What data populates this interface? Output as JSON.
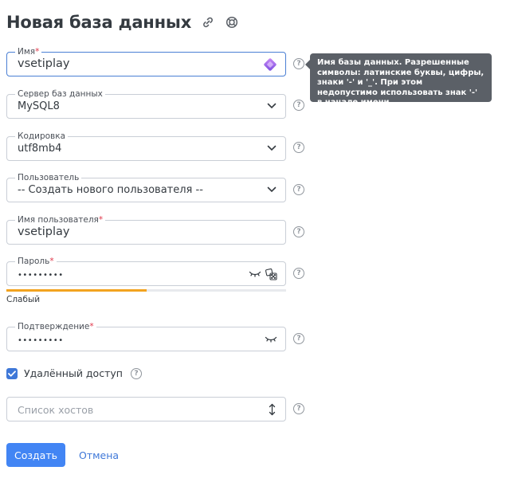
{
  "header": {
    "title": "Новая база данных",
    "icons": [
      "link-icon",
      "lifebuoy-icon"
    ]
  },
  "form": {
    "name": {
      "label": "Имя",
      "required_mark": "*",
      "value": "vsetiplay",
      "trailing_icon": "magic-gem-icon"
    },
    "server": {
      "label": "Сервер баз данных",
      "value": "MySQL8",
      "icon": "chevron-down-icon"
    },
    "encoding": {
      "label": "Кодировка",
      "value": "utf8mb4",
      "icon": "chevron-down-icon"
    },
    "user": {
      "label": "Пользователь",
      "value": "-- Создать нового пользователя --",
      "icon": "chevron-down-icon"
    },
    "username": {
      "label": "Имя пользователя",
      "required_mark": "*",
      "value": "vsetiplay"
    },
    "password": {
      "label": "Пароль",
      "required_mark": "*",
      "value_masked": "•••••••••",
      "icons": [
        "eye-closed-icon",
        "dice-generate-icon"
      ],
      "strength": {
        "label": "Слабый",
        "level": 0.5,
        "color": "#f2a31f"
      }
    },
    "confirm": {
      "label": "Подтверждение",
      "required_mark": "*",
      "value_masked": "•••••••••",
      "icon": "eye-closed-icon"
    },
    "remote_access": {
      "label": "Удалённый доступ",
      "checked": true
    },
    "hosts": {
      "placeholder": "Список хостов",
      "icon": "resize-vertical-icon"
    }
  },
  "help_icon_text": "?",
  "tooltip": {
    "text": "Имя базы данных. Разрешенные символы: латинские буквы, цифры, знаки '-' и '_'. При этом недопустимо использовать знак '-' в начале имени."
  },
  "actions": {
    "create_label": "Создать",
    "cancel_label": "Отмена"
  },
  "colors": {
    "primary": "#4285f4",
    "link": "#3f78d8",
    "required": "#e0364a",
    "tooltip_bg": "#5b6067",
    "weak_strength": "#f2a31f"
  }
}
